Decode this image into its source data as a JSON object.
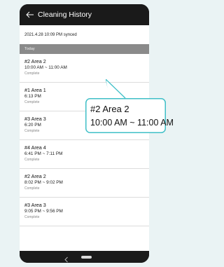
{
  "appbar": {
    "title": "Cleaning History"
  },
  "sync_status": "2021.4.28 10:09 PM synced",
  "section": {
    "label": "Today"
  },
  "history": [
    {
      "area": "#2 Area 2",
      "time": "10:00 AM ~ 11:00 AM",
      "status": "Complete"
    },
    {
      "area": "#1 Area 1",
      "time": "6:13 PM",
      "status": "Complete"
    },
    {
      "area": "#3 Area 3",
      "time": "6:20 PM",
      "status": "Complete"
    },
    {
      "area": "#4 Area 4",
      "time": "6:41 PM ~ 7:11 PM",
      "status": "Complete"
    },
    {
      "area": "#2 Area 2",
      "time": "8:02 PM ~ 9:02 PM",
      "status": "Complete"
    },
    {
      "area": "#3 Area 3",
      "time": "9:05 PM ~ 9:56 PM",
      "status": "Complete"
    }
  ],
  "callout": {
    "area": "#2 Area 2",
    "time": "10:00 AM ~ 11:00 AM"
  },
  "colors": {
    "accent": "#3fbfc7",
    "appbar": "#1a1a1a",
    "section_header": "#8a8a8a",
    "background": "#eaf3f4"
  },
  "icons": {
    "back": "arrow-left-icon",
    "nav_back": "chevron-left-icon",
    "nav_home": "home-pill-icon"
  }
}
